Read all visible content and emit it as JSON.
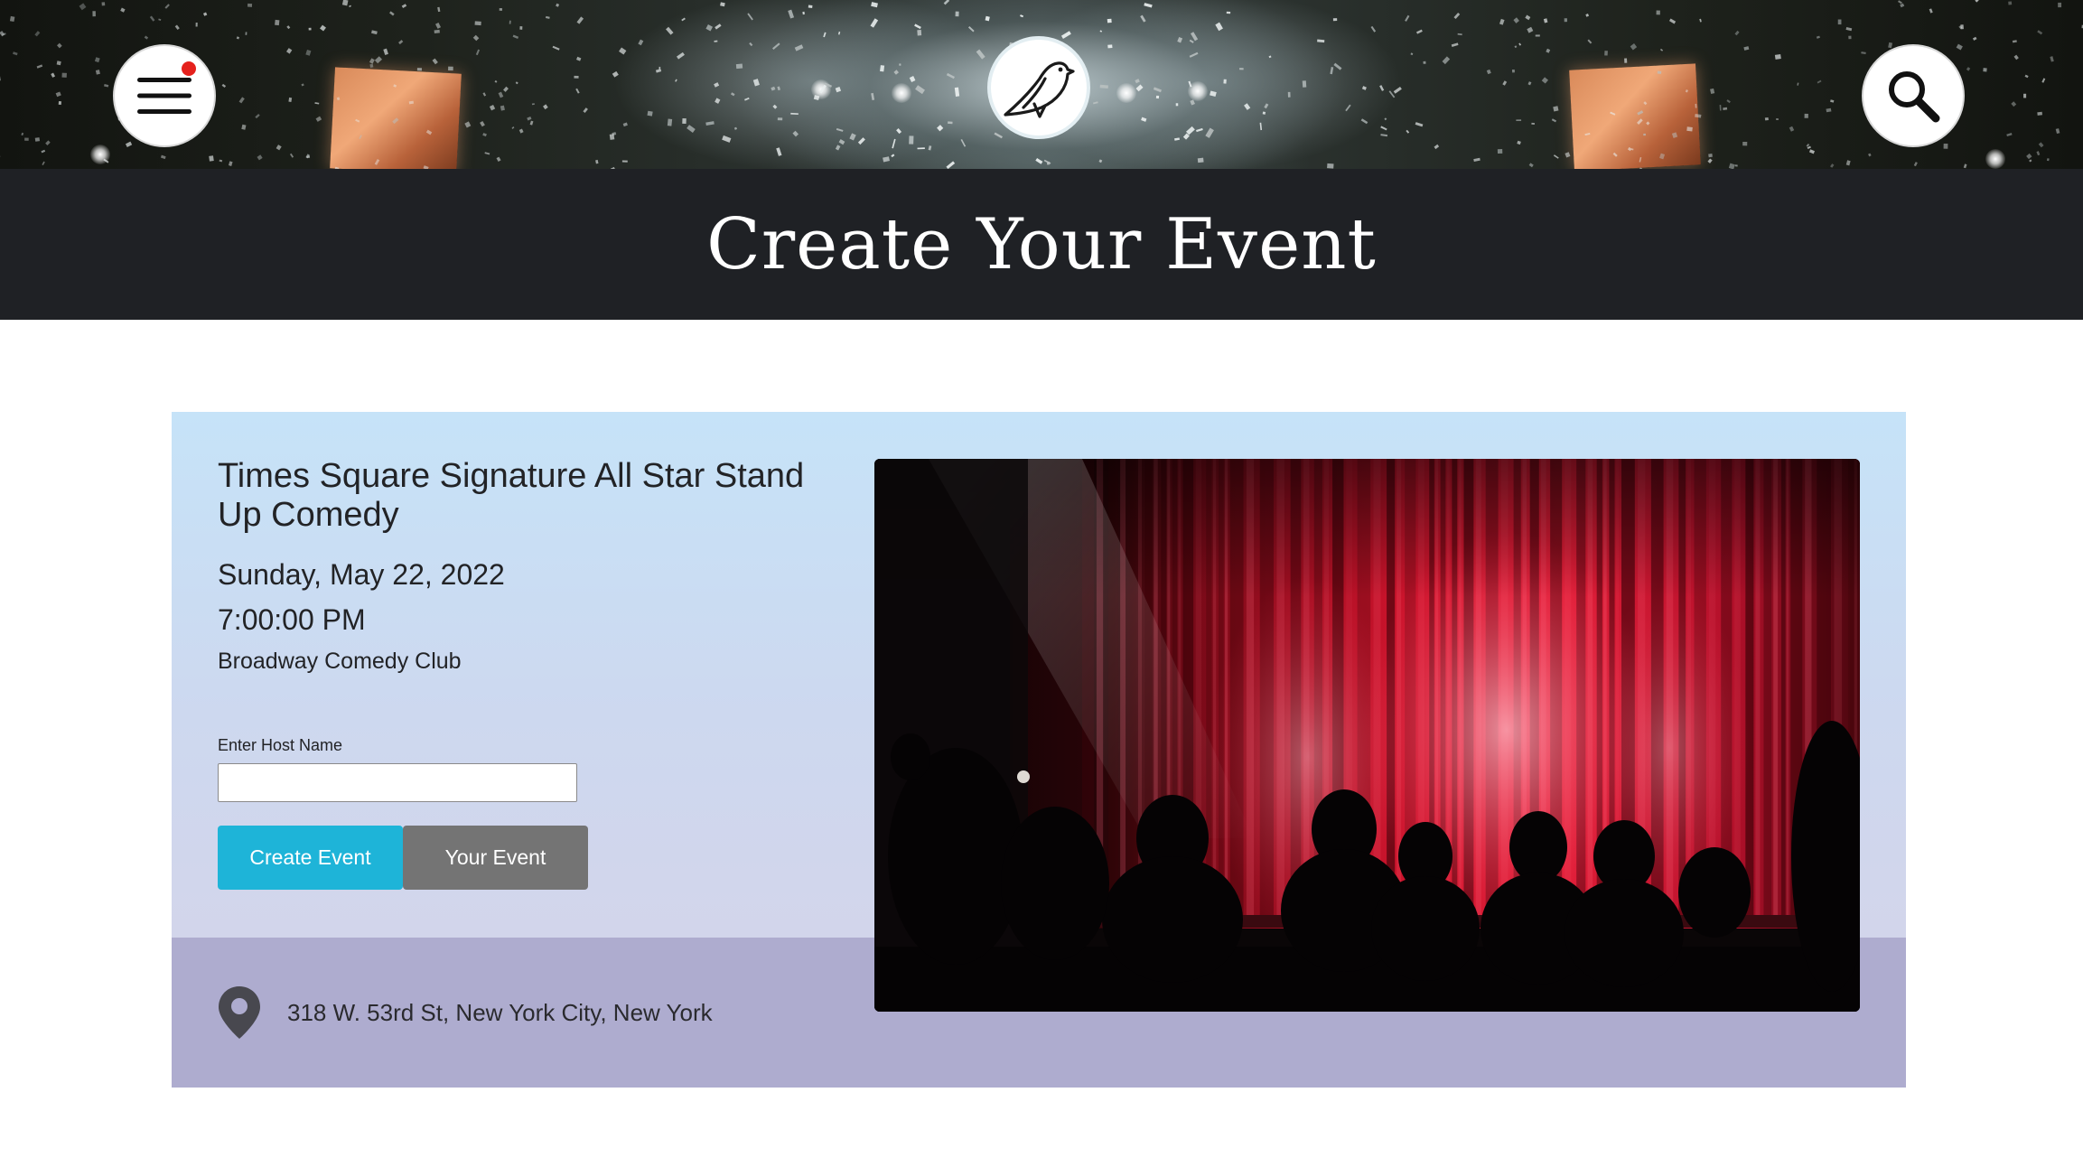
{
  "header": {
    "menu_icon": "hamburger-menu-icon",
    "menu_has_notification": true,
    "logo_icon": "bird-logo-icon",
    "search_icon": "magnifier-search-icon",
    "banner_image": "concert-confetti-photo"
  },
  "page": {
    "title": "Create Your Event"
  },
  "event": {
    "title": "Times Square Signature All Star Stand Up Comedy",
    "date": "Sunday, May 22, 2022",
    "time": "7:00:00 PM",
    "venue": "Broadway Comedy Club",
    "image": "theater-red-curtain-photo"
  },
  "form": {
    "host_label": "Enter Host Name",
    "host_value": "",
    "create_button": "Create Event",
    "your_event_button": "Your Event"
  },
  "location": {
    "icon": "map-pin-icon",
    "address": "318 W. 53rd St, New York City, New York"
  },
  "colors": {
    "title_bar": "#1f2125",
    "create_button": "#1eb4d8",
    "your_event_button": "#747474",
    "card_footer": "#aeaccf",
    "notification_dot": "#e5211d"
  }
}
